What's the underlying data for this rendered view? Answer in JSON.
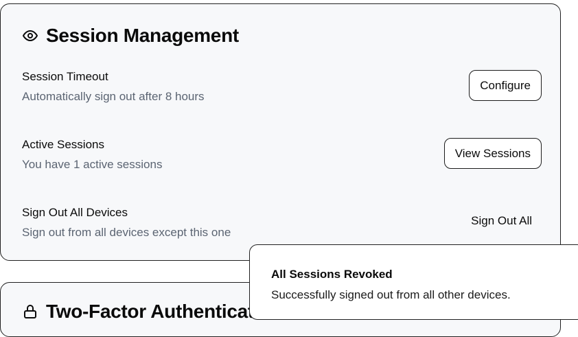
{
  "session_card": {
    "icon": "eye-icon",
    "title": "Session Management",
    "rows": [
      {
        "title": "Session Timeout",
        "description": "Automatically sign out after 8 hours",
        "action_label": "Configure"
      },
      {
        "title": "Active Sessions",
        "description": "You have 1 active sessions",
        "action_label": "View Sessions"
      },
      {
        "title": "Sign Out All Devices",
        "description": "Sign out from all devices except this one",
        "action_label": "Sign Out All"
      }
    ]
  },
  "next_card": {
    "icon": "lock-icon",
    "title": "Two-Factor Authentication"
  },
  "toast": {
    "title": "All Sessions Revoked",
    "description": "Successfully signed out from all other devices."
  }
}
